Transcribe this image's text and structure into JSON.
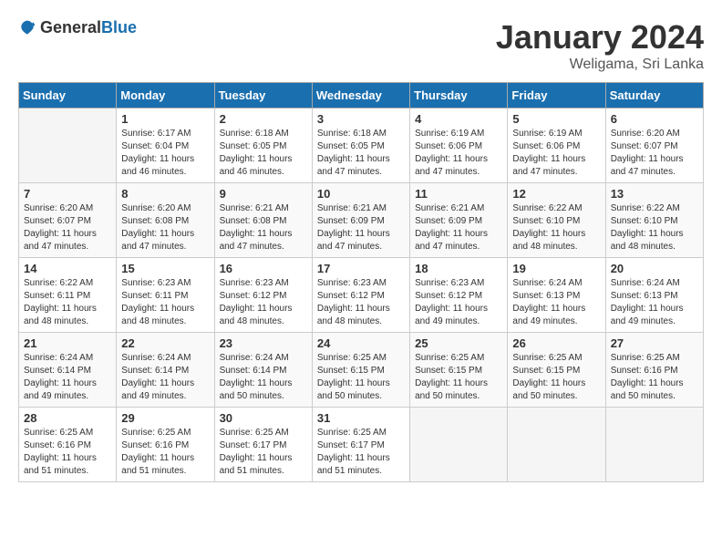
{
  "header": {
    "logo_general": "General",
    "logo_blue": "Blue",
    "title": "January 2024",
    "subtitle": "Weligama, Sri Lanka"
  },
  "days_of_week": [
    "Sunday",
    "Monday",
    "Tuesday",
    "Wednesday",
    "Thursday",
    "Friday",
    "Saturday"
  ],
  "weeks": [
    [
      {
        "day": "",
        "empty": true
      },
      {
        "day": "1",
        "sunrise": "Sunrise: 6:17 AM",
        "sunset": "Sunset: 6:04 PM",
        "daylight": "Daylight: 11 hours and 46 minutes."
      },
      {
        "day": "2",
        "sunrise": "Sunrise: 6:18 AM",
        "sunset": "Sunset: 6:05 PM",
        "daylight": "Daylight: 11 hours and 46 minutes."
      },
      {
        "day": "3",
        "sunrise": "Sunrise: 6:18 AM",
        "sunset": "Sunset: 6:05 PM",
        "daylight": "Daylight: 11 hours and 47 minutes."
      },
      {
        "day": "4",
        "sunrise": "Sunrise: 6:19 AM",
        "sunset": "Sunset: 6:06 PM",
        "daylight": "Daylight: 11 hours and 47 minutes."
      },
      {
        "day": "5",
        "sunrise": "Sunrise: 6:19 AM",
        "sunset": "Sunset: 6:06 PM",
        "daylight": "Daylight: 11 hours and 47 minutes."
      },
      {
        "day": "6",
        "sunrise": "Sunrise: 6:20 AM",
        "sunset": "Sunset: 6:07 PM",
        "daylight": "Daylight: 11 hours and 47 minutes."
      }
    ],
    [
      {
        "day": "7",
        "sunrise": "Sunrise: 6:20 AM",
        "sunset": "Sunset: 6:07 PM",
        "daylight": "Daylight: 11 hours and 47 minutes."
      },
      {
        "day": "8",
        "sunrise": "Sunrise: 6:20 AM",
        "sunset": "Sunset: 6:08 PM",
        "daylight": "Daylight: 11 hours and 47 minutes."
      },
      {
        "day": "9",
        "sunrise": "Sunrise: 6:21 AM",
        "sunset": "Sunset: 6:08 PM",
        "daylight": "Daylight: 11 hours and 47 minutes."
      },
      {
        "day": "10",
        "sunrise": "Sunrise: 6:21 AM",
        "sunset": "Sunset: 6:09 PM",
        "daylight": "Daylight: 11 hours and 47 minutes."
      },
      {
        "day": "11",
        "sunrise": "Sunrise: 6:21 AM",
        "sunset": "Sunset: 6:09 PM",
        "daylight": "Daylight: 11 hours and 47 minutes."
      },
      {
        "day": "12",
        "sunrise": "Sunrise: 6:22 AM",
        "sunset": "Sunset: 6:10 PM",
        "daylight": "Daylight: 11 hours and 48 minutes."
      },
      {
        "day": "13",
        "sunrise": "Sunrise: 6:22 AM",
        "sunset": "Sunset: 6:10 PM",
        "daylight": "Daylight: 11 hours and 48 minutes."
      }
    ],
    [
      {
        "day": "14",
        "sunrise": "Sunrise: 6:22 AM",
        "sunset": "Sunset: 6:11 PM",
        "daylight": "Daylight: 11 hours and 48 minutes."
      },
      {
        "day": "15",
        "sunrise": "Sunrise: 6:23 AM",
        "sunset": "Sunset: 6:11 PM",
        "daylight": "Daylight: 11 hours and 48 minutes."
      },
      {
        "day": "16",
        "sunrise": "Sunrise: 6:23 AM",
        "sunset": "Sunset: 6:12 PM",
        "daylight": "Daylight: 11 hours and 48 minutes."
      },
      {
        "day": "17",
        "sunrise": "Sunrise: 6:23 AM",
        "sunset": "Sunset: 6:12 PM",
        "daylight": "Daylight: 11 hours and 48 minutes."
      },
      {
        "day": "18",
        "sunrise": "Sunrise: 6:23 AM",
        "sunset": "Sunset: 6:12 PM",
        "daylight": "Daylight: 11 hours and 49 minutes."
      },
      {
        "day": "19",
        "sunrise": "Sunrise: 6:24 AM",
        "sunset": "Sunset: 6:13 PM",
        "daylight": "Daylight: 11 hours and 49 minutes."
      },
      {
        "day": "20",
        "sunrise": "Sunrise: 6:24 AM",
        "sunset": "Sunset: 6:13 PM",
        "daylight": "Daylight: 11 hours and 49 minutes."
      }
    ],
    [
      {
        "day": "21",
        "sunrise": "Sunrise: 6:24 AM",
        "sunset": "Sunset: 6:14 PM",
        "daylight": "Daylight: 11 hours and 49 minutes."
      },
      {
        "day": "22",
        "sunrise": "Sunrise: 6:24 AM",
        "sunset": "Sunset: 6:14 PM",
        "daylight": "Daylight: 11 hours and 49 minutes."
      },
      {
        "day": "23",
        "sunrise": "Sunrise: 6:24 AM",
        "sunset": "Sunset: 6:14 PM",
        "daylight": "Daylight: 11 hours and 50 minutes."
      },
      {
        "day": "24",
        "sunrise": "Sunrise: 6:25 AM",
        "sunset": "Sunset: 6:15 PM",
        "daylight": "Daylight: 11 hours and 50 minutes."
      },
      {
        "day": "25",
        "sunrise": "Sunrise: 6:25 AM",
        "sunset": "Sunset: 6:15 PM",
        "daylight": "Daylight: 11 hours and 50 minutes."
      },
      {
        "day": "26",
        "sunrise": "Sunrise: 6:25 AM",
        "sunset": "Sunset: 6:15 PM",
        "daylight": "Daylight: 11 hours and 50 minutes."
      },
      {
        "day": "27",
        "sunrise": "Sunrise: 6:25 AM",
        "sunset": "Sunset: 6:16 PM",
        "daylight": "Daylight: 11 hours and 50 minutes."
      }
    ],
    [
      {
        "day": "28",
        "sunrise": "Sunrise: 6:25 AM",
        "sunset": "Sunset: 6:16 PM",
        "daylight": "Daylight: 11 hours and 51 minutes."
      },
      {
        "day": "29",
        "sunrise": "Sunrise: 6:25 AM",
        "sunset": "Sunset: 6:16 PM",
        "daylight": "Daylight: 11 hours and 51 minutes."
      },
      {
        "day": "30",
        "sunrise": "Sunrise: 6:25 AM",
        "sunset": "Sunset: 6:17 PM",
        "daylight": "Daylight: 11 hours and 51 minutes."
      },
      {
        "day": "31",
        "sunrise": "Sunrise: 6:25 AM",
        "sunset": "Sunset: 6:17 PM",
        "daylight": "Daylight: 11 hours and 51 minutes."
      },
      {
        "day": "",
        "empty": true
      },
      {
        "day": "",
        "empty": true
      },
      {
        "day": "",
        "empty": true
      }
    ]
  ]
}
